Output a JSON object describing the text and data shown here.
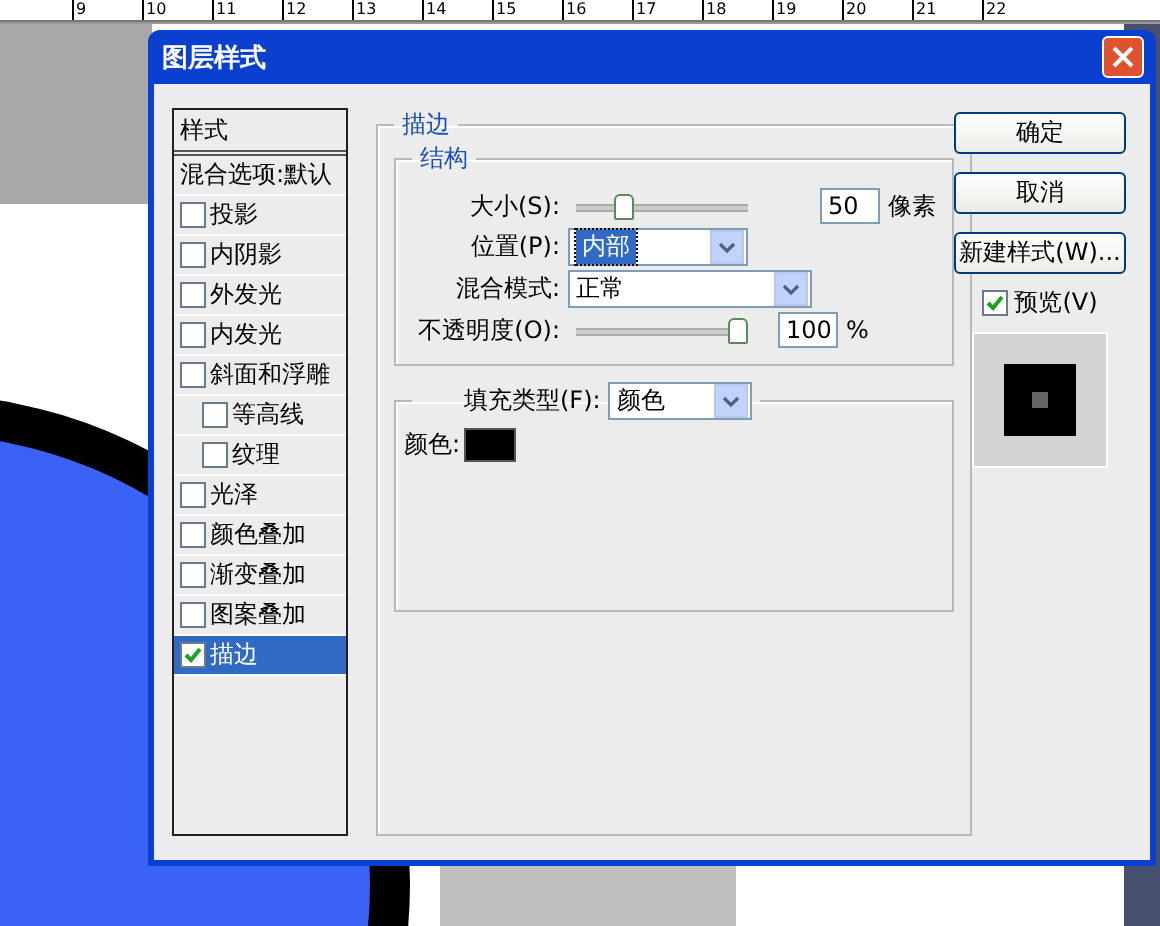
{
  "ruler": {
    "labels": [
      "9",
      "10",
      "11",
      "12",
      "13",
      "14",
      "15",
      "16",
      "17",
      "18",
      "19",
      "20",
      "21",
      "22"
    ]
  },
  "window": {
    "title": "图层样式"
  },
  "styles_panel": {
    "header": "样式",
    "items": [
      {
        "label": "混合选项:默认",
        "kind": "plain",
        "selected": false
      },
      {
        "label": "投影",
        "kind": "checkbox",
        "checked": false,
        "selected": false
      },
      {
        "label": "内阴影",
        "kind": "checkbox",
        "checked": false,
        "selected": false
      },
      {
        "label": "外发光",
        "kind": "checkbox",
        "checked": false,
        "selected": false
      },
      {
        "label": "内发光",
        "kind": "checkbox",
        "checked": false,
        "selected": false
      },
      {
        "label": "斜面和浮雕",
        "kind": "checkbox",
        "checked": false,
        "selected": false,
        "children": [
          {
            "label": "等高线",
            "kind": "checkbox",
            "checked": false,
            "selected": false
          },
          {
            "label": "纹理",
            "kind": "checkbox",
            "checked": false,
            "selected": false
          }
        ]
      },
      {
        "label": "光泽",
        "kind": "checkbox",
        "checked": false,
        "selected": false
      },
      {
        "label": "颜色叠加",
        "kind": "checkbox",
        "checked": false,
        "selected": false
      },
      {
        "label": "渐变叠加",
        "kind": "checkbox",
        "checked": false,
        "selected": false
      },
      {
        "label": "图案叠加",
        "kind": "checkbox",
        "checked": false,
        "selected": false
      },
      {
        "label": "描边",
        "kind": "checkbox",
        "checked": true,
        "selected": true
      }
    ]
  },
  "stroke": {
    "title": "描边",
    "structure": {
      "title": "结构",
      "size": {
        "label": "大小(S):",
        "level": 0.25,
        "value": "50",
        "unit": "像素"
      },
      "position": {
        "label": "位置(P):",
        "value": "内部"
      },
      "blend_mode": {
        "label": "混合模式:",
        "value": "正常"
      },
      "opacity": {
        "label": "不透明度(O):",
        "level": 1.0,
        "value": "100",
        "unit": "%"
      }
    },
    "fill": {
      "type_label": "填充类型(F):",
      "type_value": "颜色",
      "color_label": "颜色:",
      "color": "#000000"
    }
  },
  "buttons": [
    "确定",
    "取消",
    "新建样式(W)..."
  ],
  "preview": {
    "label": "预览(V)",
    "checked": true
  }
}
